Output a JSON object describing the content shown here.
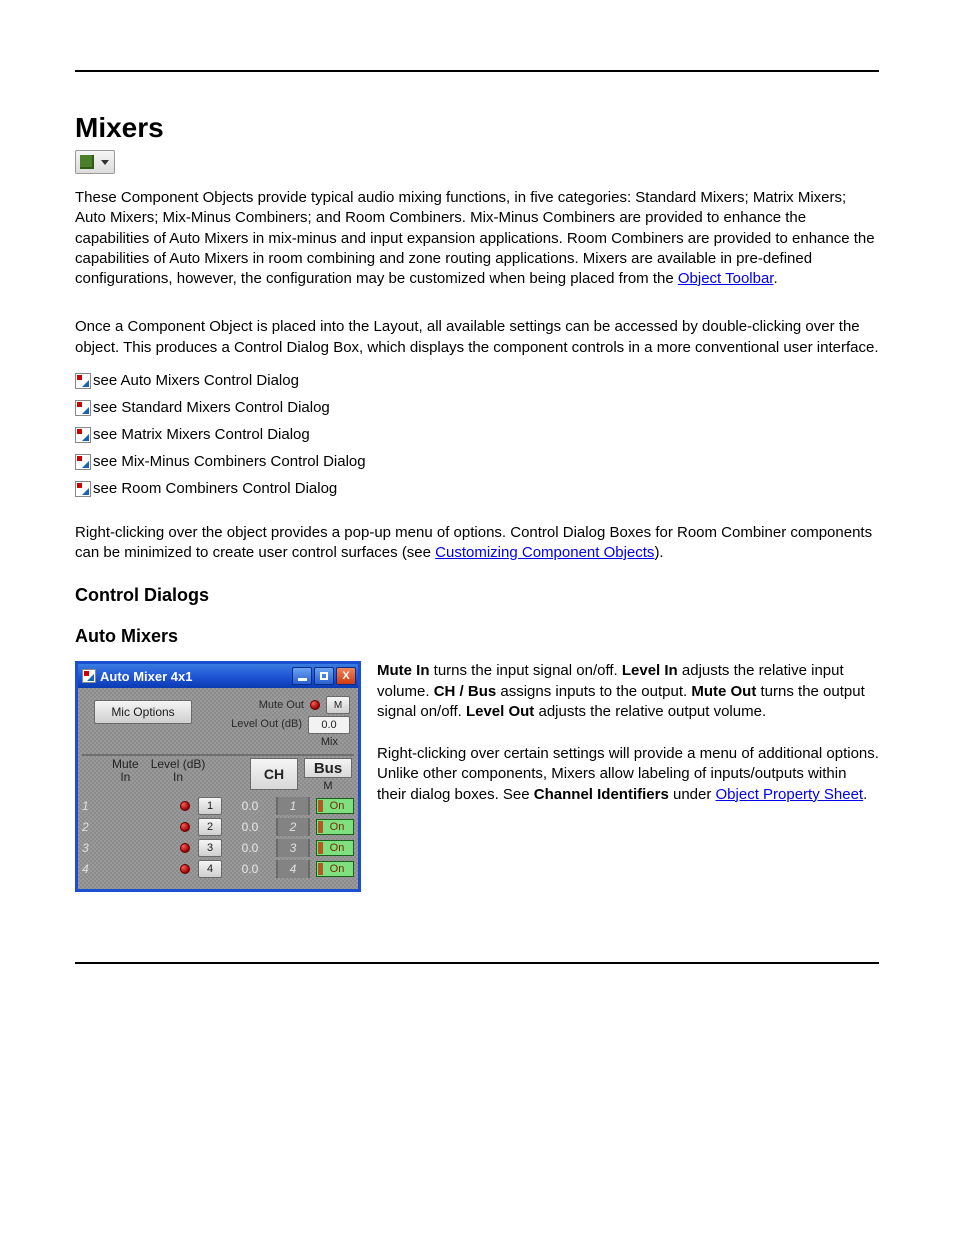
{
  "heading_main": "Mixers",
  "intro_paragraph_pre": "These Component Objects provide typical audio mixing functions, in five categories: Standard Mixers; Matrix Mixers; Auto Mixers; Mix-Minus Combiners; and Room Combiners. Mix-Minus Combiners are provided to enhance the capabilities of Auto Mixers in mix-minus and input expansion applications. Room Combiners are provided to enhance the capabilities of Auto Mixers in room combining and zone routing applications. Mixers are available in pre-defined configurations, however, the configuration may be customized when being placed from the ",
  "link_object_toolbar": "Object Toolbar",
  "intro_paragraph_post": ".",
  "paragraph2": "Once a Component Object is placed into the Layout, all available settings can be accessed by double-clicking over the object. This produces a Control Dialog Box, which displays the component controls in a more conventional user interface.",
  "see_items": [
    "see Auto Mixers Control Dialog",
    "see Standard Mixers Control Dialog",
    "see Matrix Mixers Control Dialog",
    "see Mix-Minus Combiners Control Dialog",
    "see Room Combiners Control Dialog"
  ],
  "paragraph3_pre": "Right-clicking over the object provides a pop-up menu of options. Control Dialog Boxes for Room Combiner components can be minimized to create user control surfaces (see ",
  "link_customizing": "Customizing Component Objects",
  "paragraph3_post": ").",
  "heading_control_dialogs": "Control Dialogs",
  "heading_sub_auto": "Auto Mixers",
  "dialog": {
    "title": "Auto Mixer 4x1",
    "mic_options": "Mic Options",
    "mute_out_label": "Mute Out",
    "level_out_label": "Level Out (dB)",
    "m_button": "M",
    "level_out_value": "0.0",
    "mix_label": "Mix",
    "col_mute": "Mute",
    "col_level": "Level (dB)",
    "col_in": "In",
    "col_ch": "CH",
    "col_bus": "Bus",
    "col_bus_m": "M",
    "rows": [
      {
        "idx": "1",
        "num": "1",
        "lvl": "0.0",
        "ch": "1",
        "bus": "On"
      },
      {
        "idx": "2",
        "num": "2",
        "lvl": "0.0",
        "ch": "2",
        "bus": "On"
      },
      {
        "idx": "3",
        "num": "3",
        "lvl": "0.0",
        "ch": "3",
        "bus": "On"
      },
      {
        "idx": "4",
        "num": "4",
        "lvl": "0.0",
        "ch": "4",
        "bus": "On"
      }
    ]
  },
  "desc": {
    "mute_in": "Mute In",
    "mute_in_txt": " turns the input signal on/off. ",
    "level_in": "Level In",
    "level_in_txt": " adjusts the relative input volume. ",
    "ch_bus": "CH / Bus",
    "ch_bus_txt": " assigns inputs to the output. ",
    "mute_out": "Mute Out",
    "mute_out_txt": " turns the output signal on/off. ",
    "level_out": "Level Out",
    "level_out_txt": " adjusts the relative output volume."
  },
  "desc2_pre": "Right-clicking over certain settings will provide a menu of additional options. Unlike other components, Mixers allow labeling of inputs/outputs within their dialog boxes. See ",
  "desc2_bold": "Channel Identifiers",
  "desc2_mid": " under ",
  "link_ops": "Object Property Sheet",
  "desc2_post": "."
}
